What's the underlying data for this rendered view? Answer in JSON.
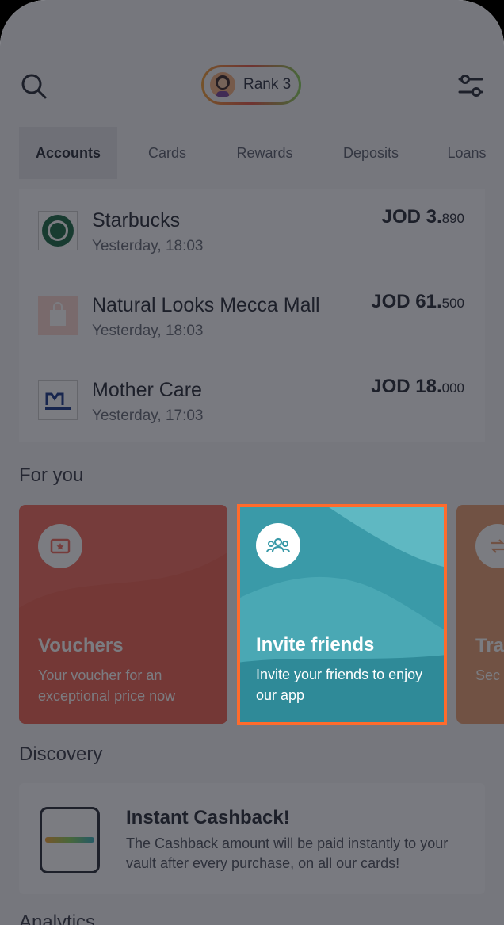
{
  "header": {
    "rank_label": "Rank 3"
  },
  "tabs": [
    {
      "label": "Accounts"
    },
    {
      "label": "Cards"
    },
    {
      "label": "Rewards"
    },
    {
      "label": "Deposits"
    },
    {
      "label": "Loans"
    }
  ],
  "transactions": [
    {
      "name": "Starbucks",
      "time": "Yesterday, 18:03",
      "amount_main": "JOD 3.",
      "amount_dec": "890",
      "logo": "starbucks-logo"
    },
    {
      "name": "Natural Looks Mecca Mall",
      "time": "Yesterday, 18:03",
      "amount_main": "JOD 61.",
      "amount_dec": "500",
      "logo": "shopping-bag-icon"
    },
    {
      "name": "Mother Care",
      "time": "Yesterday, 17:03",
      "amount_main": "JOD 18.",
      "amount_dec": "000",
      "logo": "mothercare-logo"
    }
  ],
  "for_you": {
    "title": "For you",
    "cards": [
      {
        "title": "Vouchers",
        "subtitle": "Your voucher for an exceptional price now",
        "icon": "voucher-icon",
        "color": "#f36f60"
      },
      {
        "title": "Invite friends",
        "subtitle": "Invite your friends to enjoy our app",
        "icon": "group-icon",
        "color": "#3a9aa8"
      },
      {
        "title": "Tra",
        "subtitle": "Sec noth",
        "icon": "transfer-icon",
        "color": "#e8a074"
      }
    ]
  },
  "discovery": {
    "title": "Discovery",
    "card_title": "Instant Cashback!",
    "card_text": "The Cashback amount will be paid instantly to your vault after every purchase, on all our cards!"
  },
  "analytics": {
    "title": "Analytics"
  },
  "colors": {
    "highlight": "#ff6b2c",
    "teal": "#3a9aa8",
    "coral": "#f36f60"
  }
}
